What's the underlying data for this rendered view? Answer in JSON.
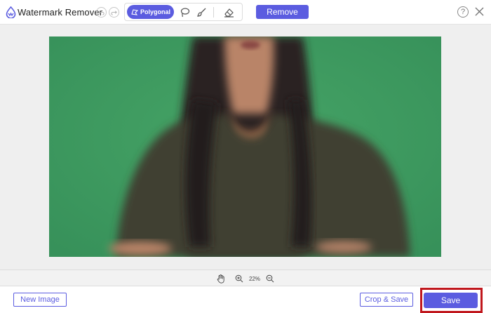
{
  "app": {
    "title": "Watermark Remover"
  },
  "toolbar": {
    "undo_icon": "undo-icon",
    "redo_icon": "redo-icon",
    "tools": [
      {
        "id": "polygonal",
        "label": "Polygonal",
        "icon": "polygon-icon",
        "active": true
      },
      {
        "id": "lasso",
        "icon": "lasso-icon",
        "active": false
      },
      {
        "id": "brush",
        "icon": "brush-icon",
        "active": false
      },
      {
        "id": "eraser",
        "icon": "eraser-icon",
        "active": false
      }
    ],
    "remove_label": "Remove",
    "help_label": "?",
    "close_icon": "close-icon"
  },
  "canvas": {
    "background_color": "#efefef",
    "image_description_hidden": true
  },
  "zoom": {
    "hand_icon": "hand-icon",
    "zoom_in_icon": "zoom-in-icon",
    "level": "22%",
    "zoom_out_icon": "zoom-out-icon"
  },
  "footer": {
    "new_image_label": "New Image",
    "crop_save_label": "Crop & Save",
    "save_label": "Save"
  },
  "colors": {
    "accent": "#5b5ce0",
    "highlight_border": "#c0171d",
    "greenscreen": "#3d9a5d"
  }
}
